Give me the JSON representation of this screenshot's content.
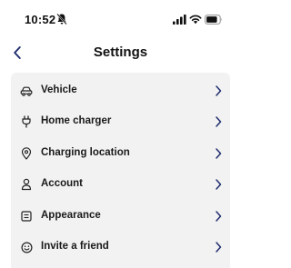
{
  "status_bar": {
    "time": "10:52",
    "icons": [
      "bell-slash-icon",
      "signal-icon",
      "wifi-icon",
      "battery-icon"
    ]
  },
  "header": {
    "title": "Settings",
    "back_icon": "chevron-left-icon"
  },
  "settings": {
    "items": [
      {
        "label": "Vehicle",
        "icon": "car-icon"
      },
      {
        "label": "Home charger",
        "icon": "plug-icon"
      },
      {
        "label": "Charging location",
        "icon": "location-pin-icon"
      },
      {
        "label": "Account",
        "icon": "person-icon"
      },
      {
        "label": "Appearance",
        "icon": "appearance-icon"
      },
      {
        "label": "Invite a friend",
        "icon": "smiley-icon"
      }
    ]
  },
  "colors": {
    "accent": "#1f2d6e",
    "card_background": "#f2f2f2",
    "text": "#111111"
  }
}
